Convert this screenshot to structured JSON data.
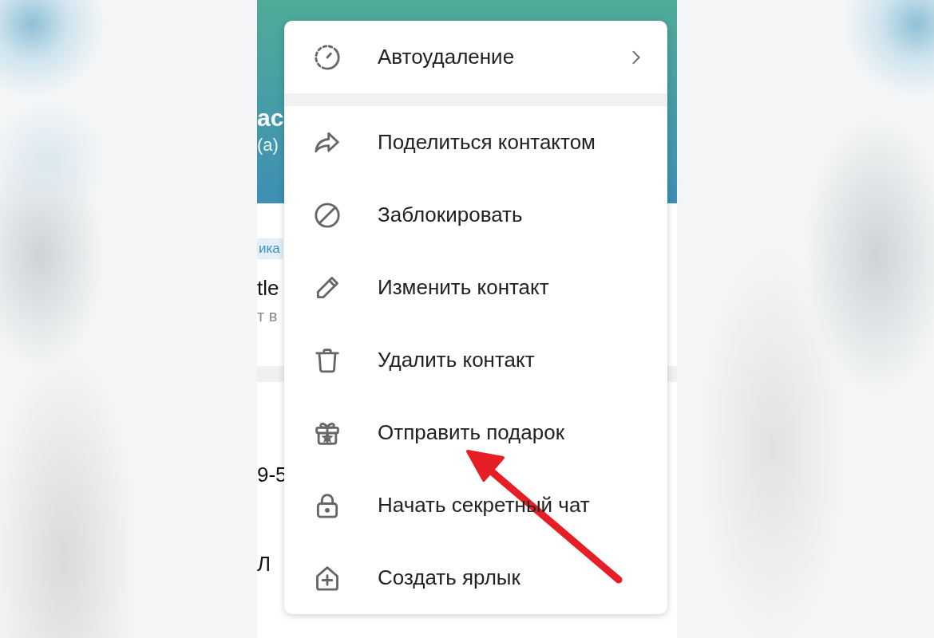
{
  "profile_behind_menu": {
    "name": "ас",
    "status": "(а)",
    "tag": "ика",
    "username": "tle",
    "username_note": "т в",
    "phone": "9-5",
    "about": "Л"
  },
  "menu": {
    "groups": [
      [
        {
          "kind": "submenu",
          "label": "Автоудаление"
        }
      ],
      [
        {
          "kind": "action",
          "label": "Поделиться контактом"
        },
        {
          "kind": "action",
          "label": "Заблокировать"
        },
        {
          "kind": "action",
          "label": "Изменить контакт"
        },
        {
          "kind": "action",
          "label": "Удалить контакт"
        },
        {
          "kind": "action",
          "label": "Отправить подарок"
        },
        {
          "kind": "action",
          "label": "Начать секретный чат"
        },
        {
          "kind": "action",
          "label": "Создать ярлык"
        }
      ]
    ]
  }
}
